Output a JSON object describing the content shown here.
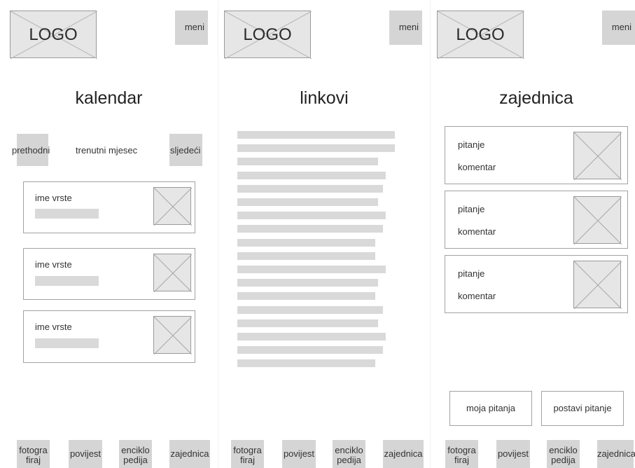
{
  "screens": {
    "kalendar": {
      "logo": "LOGO",
      "menu": "meni",
      "title": "kalendar",
      "prev": "prethodni",
      "current": "trenutni mjesec",
      "next": "sljedeći",
      "cards": [
        {
          "label": "ime vrste"
        },
        {
          "label": "ime vrste"
        },
        {
          "label": "ime vrste"
        }
      ]
    },
    "linkovi": {
      "logo": "LOGO",
      "menu": "meni",
      "title": "linkovi",
      "link_count": 18
    },
    "zajednica": {
      "logo": "LOGO",
      "menu": "meni",
      "title": "zajednica",
      "posts": [
        {
          "question": "pitanje",
          "comment": "komentar"
        },
        {
          "question": "pitanje",
          "comment": "komentar"
        },
        {
          "question": "pitanje",
          "comment": "komentar"
        }
      ],
      "my_questions": "moja pitanja",
      "ask_question": "postavi pitanje"
    }
  },
  "bottom_nav": {
    "photo_line1": "fotogra",
    "photo_line2": "firaj",
    "history": "povijest",
    "encyclopedia_line1": "enciklo",
    "encyclopedia_line2": "pedija",
    "community": "zajednica"
  }
}
